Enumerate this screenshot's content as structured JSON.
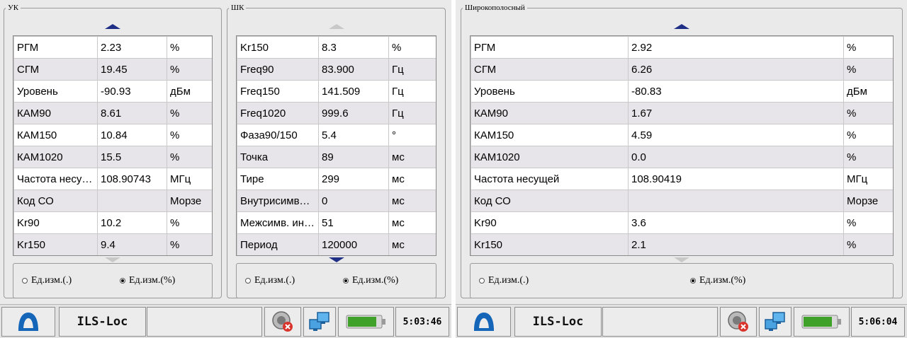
{
  "left": {
    "uk": {
      "legend": "УК",
      "rows": [
        {
          "name": "РГМ",
          "value": "2.23",
          "unit": "%"
        },
        {
          "name": "СГМ",
          "value": "19.45",
          "unit": "%"
        },
        {
          "name": "Уровень",
          "value": "-90.93",
          "unit": "дБм"
        },
        {
          "name": "КАМ90",
          "value": "8.61",
          "unit": "%"
        },
        {
          "name": "КАМ150",
          "value": "10.84",
          "unit": "%"
        },
        {
          "name": "КАМ1020",
          "value": "15.5",
          "unit": "%"
        },
        {
          "name": "Частота несущей",
          "value": "108.90743",
          "unit": "МГц"
        },
        {
          "name": "Код СО",
          "value": "",
          "unit": "Морзе"
        },
        {
          "name": "Kr90",
          "value": "10.2",
          "unit": "%"
        },
        {
          "name": "Kr150",
          "value": "9.4",
          "unit": "%"
        }
      ],
      "radio_units_dot": "Ед.изм.(.)",
      "radio_units_pct": "Ед.изм.(%)",
      "selected": "pct"
    },
    "shk": {
      "legend": "ШК",
      "rows": [
        {
          "name": "Kr150",
          "value": "8.3",
          "unit": "%"
        },
        {
          "name": "Freq90",
          "value": "83.900",
          "unit": "Гц"
        },
        {
          "name": "Freq150",
          "value": "141.509",
          "unit": "Гц"
        },
        {
          "name": "Freq1020",
          "value": "999.6",
          "unit": "Гц"
        },
        {
          "name": "Фаза90/150",
          "value": "5.4",
          "unit": "°"
        },
        {
          "name": "Точка",
          "value": "89",
          "unit": "мс"
        },
        {
          "name": "Тире",
          "value": "299",
          "unit": "мс"
        },
        {
          "name": "Внутрисимвольный",
          "value": "0",
          "unit": "мс"
        },
        {
          "name": "Межсимв. интервал",
          "value": "51",
          "unit": "мс"
        },
        {
          "name": "Период",
          "value": "120000",
          "unit": "мс"
        }
      ],
      "radio_units_dot": "Ед.изм.(.)",
      "radio_units_pct": "Ед.изм.(%)",
      "selected": "pct"
    },
    "taskbar": {
      "app_name": "ILS-Loc",
      "clock": "5:03:46"
    }
  },
  "right": {
    "wide": {
      "legend": "Широкополосный",
      "rows": [
        {
          "name": "РГМ",
          "value": "2.92",
          "unit": "%"
        },
        {
          "name": "СГМ",
          "value": "6.26",
          "unit": "%"
        },
        {
          "name": "Уровень",
          "value": "-80.83",
          "unit": "дБм"
        },
        {
          "name": "КАМ90",
          "value": "1.67",
          "unit": "%"
        },
        {
          "name": "КАМ150",
          "value": "4.59",
          "unit": "%"
        },
        {
          "name": "КАМ1020",
          "value": "0.0",
          "unit": "%"
        },
        {
          "name": "Частота несущей",
          "value": "108.90419",
          "unit": "МГц"
        },
        {
          "name": "Код СО",
          "value": "",
          "unit": "Морзе"
        },
        {
          "name": "Kr90",
          "value": "3.6",
          "unit": "%"
        },
        {
          "name": "Kr150",
          "value": "2.1",
          "unit": "%"
        }
      ],
      "radio_units_dot": "Ед.изм.(.)",
      "radio_units_pct": "Ед.изм.(%)",
      "selected": "pct"
    },
    "taskbar": {
      "app_name": "ILS-Loc",
      "clock": "5:06:04"
    }
  },
  "icons": {
    "logo": "arch-logo-icon",
    "sound": "speaker-muted-icon",
    "network": "network-monitors-icon",
    "battery": "battery-icon"
  },
  "colors": {
    "accent_arrow": "#1f2f86",
    "logo": "#1565b8",
    "battery": "#3fa12a",
    "stripe": "#e7e5e9"
  }
}
